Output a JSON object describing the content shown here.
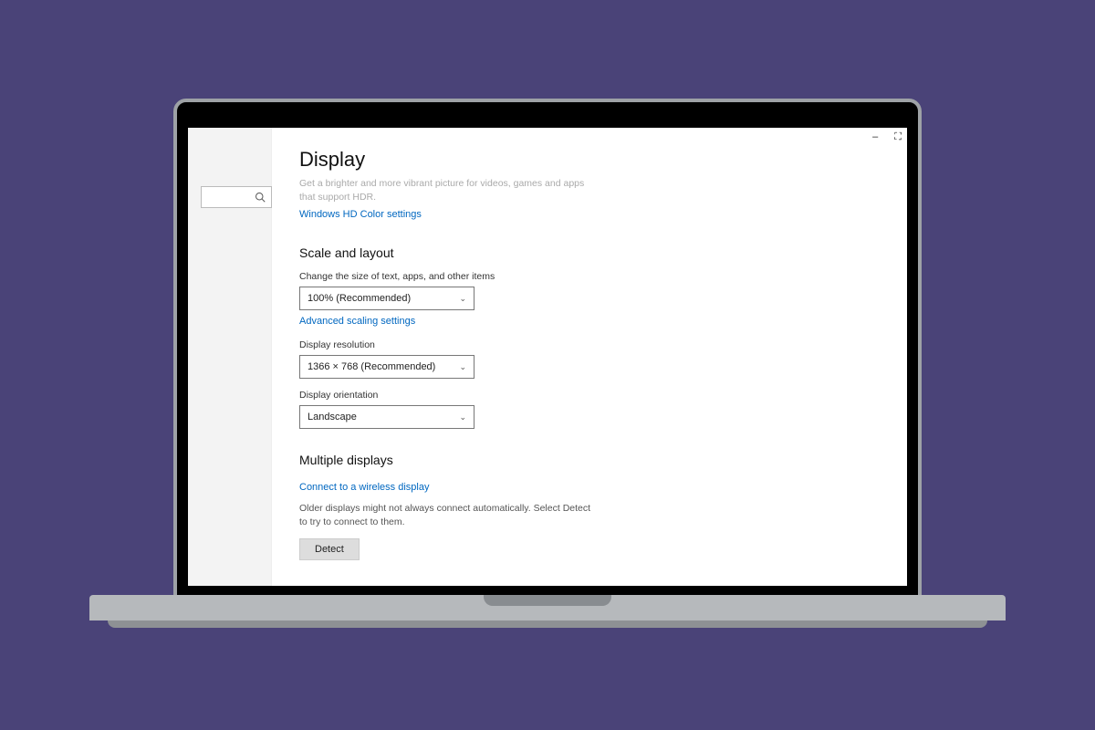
{
  "window": {
    "minimize": "–",
    "maximize": "⛶"
  },
  "page": {
    "title": "Display",
    "hdr_desc": "Get a brighter and more vibrant picture for videos, games and apps that support HDR.",
    "hdr_link": "Windows HD Color settings"
  },
  "scale": {
    "heading": "Scale and layout",
    "size_label": "Change the size of text, apps, and other items",
    "size_value": "100% (Recommended)",
    "advanced_link": "Advanced scaling settings",
    "resolution_label": "Display resolution",
    "resolution_value": "1366 × 768 (Recommended)",
    "orientation_label": "Display orientation",
    "orientation_value": "Landscape"
  },
  "multiple": {
    "heading": "Multiple displays",
    "wireless_link": "Connect to a wireless display",
    "detect_desc": "Older displays might not always connect automatically. Select Detect to try to connect to them.",
    "detect_button": "Detect"
  }
}
